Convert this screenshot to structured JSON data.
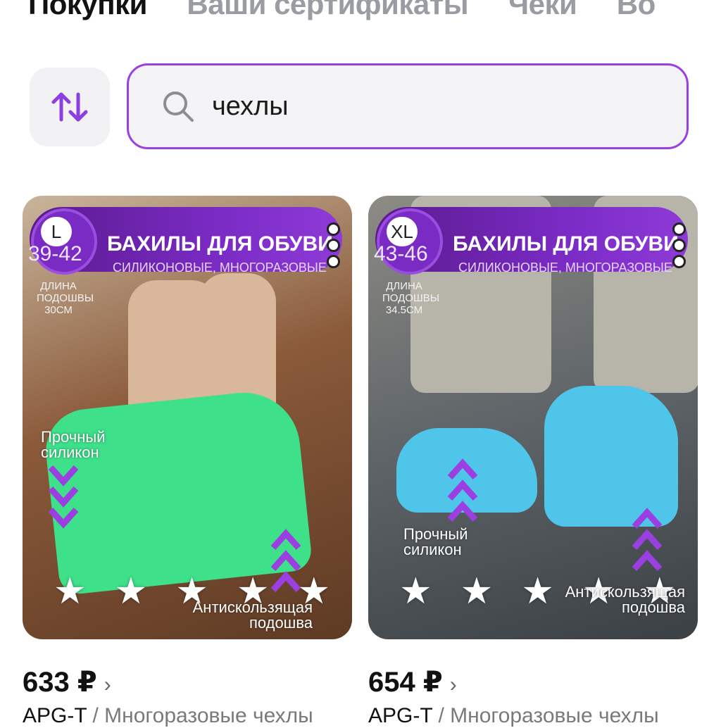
{
  "tabs": [
    "Покупки",
    "Ваши сертификаты",
    "Чеки",
    "Во"
  ],
  "search": {
    "value": "чехлы"
  },
  "products": [
    {
      "size": "L",
      "size_range": "39-42",
      "banner_title": "БАХИЛЫ ДЛЯ ОБУВИ",
      "banner_sub": "СИЛИКОНОВЫЕ, МНОГОРАЗОВЫЕ",
      "sole_info": [
        "ДЛИНА",
        "ПОДОШВЫ",
        "30СМ"
      ],
      "feature_1": [
        "Прочный",
        "силикон"
      ],
      "feature_2": [
        "Антискользящая",
        "подошва"
      ],
      "rating": 5,
      "price": "633 ₽",
      "brand": "APG-T",
      "name": "/ Многоразовые чехлы"
    },
    {
      "size": "XL",
      "size_range": "43-46",
      "banner_title": "БАХИЛЫ ДЛЯ ОБУВИ",
      "banner_sub": "СИЛИКОНОВЫЕ, МНОГОРАЗОВЫЕ",
      "sole_info": [
        "ДЛИНА",
        "ПОДОШВЫ",
        "34.5СМ"
      ],
      "feature_1": [
        "Прочный",
        "силикон"
      ],
      "feature_2": [
        "Антискользящая",
        "подошва"
      ],
      "rating": 5,
      "price": "654 ₽",
      "brand": "APG-T",
      "name": "/ Многоразовые чехлы"
    }
  ],
  "colors": {
    "accent": "#9b3fe0",
    "banner": "#7a2bc4",
    "green_cover": "#3ee08a",
    "blue_cover": "#4fc6e9"
  },
  "icons": {
    "sort": "sort-arrows-icon",
    "search": "search-icon",
    "price_arrow": "chevron-right-icon"
  }
}
